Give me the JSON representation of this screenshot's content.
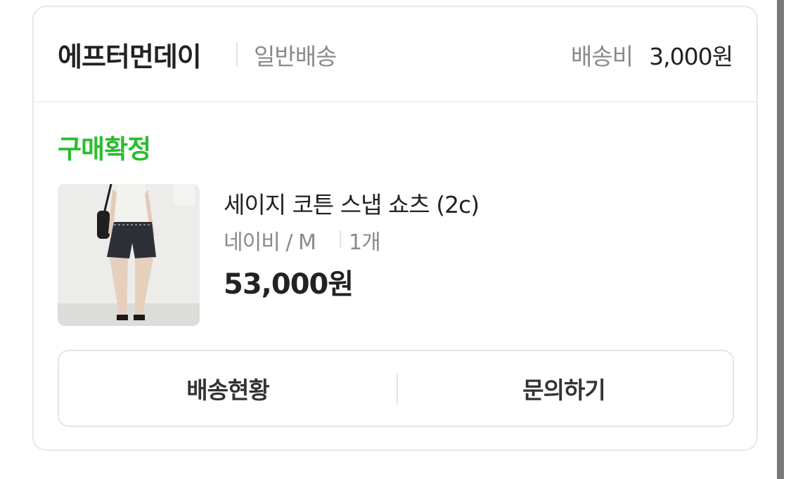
{
  "order": {
    "seller_name": "에프터먼데이",
    "shipping_type": "일반배송",
    "shipping_fee_label": "배송비",
    "shipping_fee_value": "3,000원",
    "status": "구매확정",
    "status_color": "#2bbd2f",
    "product": {
      "name": "세이지 코튼 스냅 쇼츠 (2c)",
      "option": "네이비 / M",
      "quantity": "1개",
      "price": "53,000원"
    },
    "actions": {
      "track_label": "배송현황",
      "inquiry_label": "문의하기"
    }
  }
}
